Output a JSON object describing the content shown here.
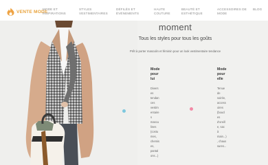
{
  "brand": {
    "name": "VENTE MODE",
    "logo_icon": "flame-icon",
    "accent": "#e8a33c"
  },
  "nav": {
    "items": [
      {
        "id": "mode",
        "lines": [
          "MODE ET",
          "INSPIRATIONS"
        ]
      },
      {
        "id": "styles",
        "lines": [
          "STYLES",
          "VESTIMENTAIRES"
        ]
      },
      {
        "id": "defiles",
        "lines": [
          "DÉFILÉS ET",
          "ÉVÉNEMENTS"
        ]
      },
      {
        "id": "haute",
        "lines": [
          "HAUTE",
          "COUTURE"
        ]
      },
      {
        "id": "beaute",
        "lines": [
          "BEAUTÉ ET",
          "ESTHÉTIQUE"
        ]
      },
      {
        "id": "accessoires",
        "lines": [
          "ACCESSOIRES DE",
          "MODE"
        ]
      },
      {
        "id": "blog",
        "lines": [
          "BLOG"
        ]
      }
    ]
  },
  "hero": {
    "heading": "moment",
    "subheading": "Tous les styles pour tous les goûts",
    "tagline": "Prêt à porter masculin et féminin pour un look vestimentaire tendance"
  },
  "columns": [
    {
      "title_lines": [
        "Mode",
        "pour",
        "lui"
      ],
      "text_lines": [
        "Divers",
        "es",
        "tendan",
        "ces",
        "vestim",
        "entaire",
        "s",
        "mascu",
        "lines",
        "(costu",
        "mes,",
        "chemis",
        "es,",
        "pantal",
        "ons...)"
      ]
    },
    {
      "title_lines": [
        "Mode",
        "pour",
        "elle"
      ],
      "text_lines": [
        "Tenue",
        "de",
        "soirée,",
        "access",
        "oires",
        "(boucl",
        "es",
        "d'oreill",
        "e, sac",
        "à",
        "main...)",
        ", chaus",
        "sures..."
      ]
    }
  ],
  "carousel": {
    "dot_colors": [
      "#7ec8de",
      "#f28aa6"
    ]
  }
}
